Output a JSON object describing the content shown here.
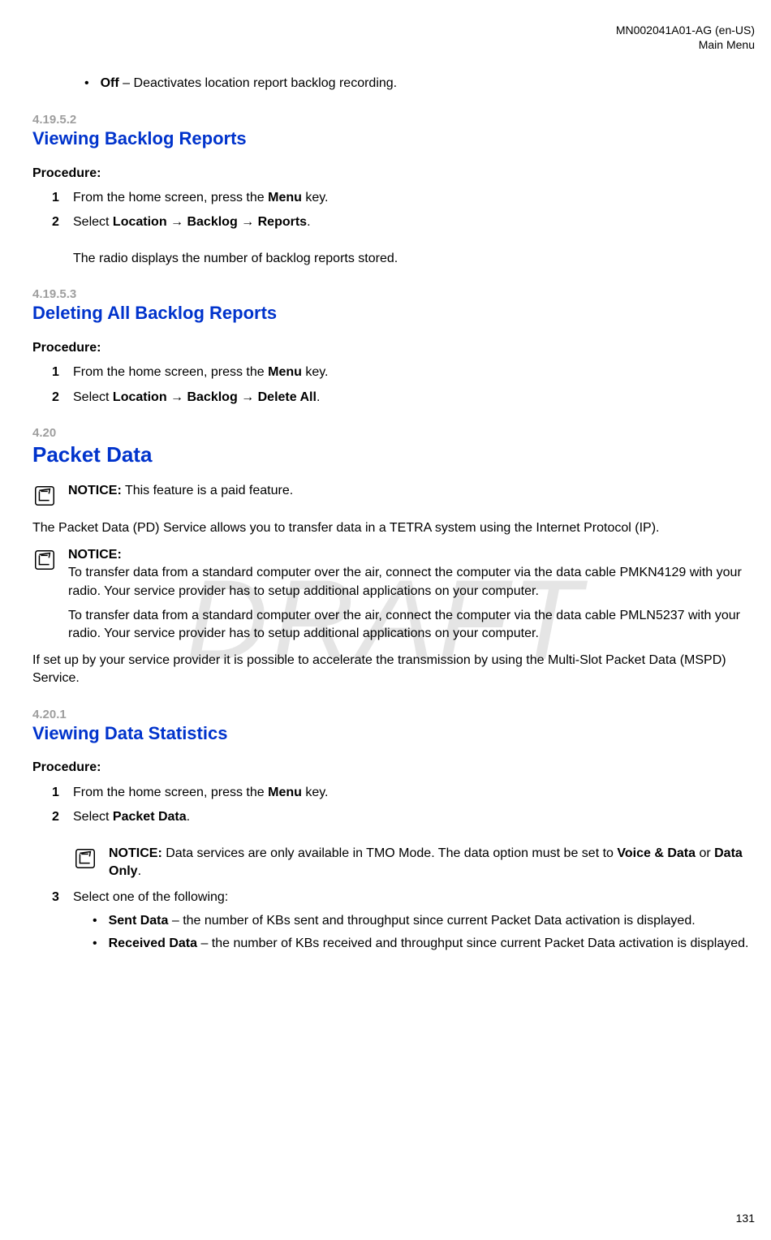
{
  "watermark": "DRAFT",
  "header": {
    "doc_id": "MN002041A01-AG (en-US)",
    "section": "Main Menu"
  },
  "page_number": "131",
  "intro_bullet": {
    "term": "Off",
    "desc": " – Deactivates location report backlog recording."
  },
  "s41952": {
    "num": "4.19.5.2",
    "title": "Viewing Backlog Reports",
    "proc_label": "Procedure:",
    "step1_a": "From the home screen, press the ",
    "step1_b": "Menu",
    "step1_c": " key.",
    "step2_a": "Select ",
    "step2_b": "Location → Backlog → Reports",
    "step2_c": ".",
    "result": "The radio displays the number of backlog reports stored."
  },
  "s41953": {
    "num": "4.19.5.3",
    "title": "Deleting All Backlog Reports",
    "proc_label": "Procedure:",
    "step1_a": "From the home screen, press the ",
    "step1_b": "Menu",
    "step1_c": " key.",
    "step2_a": "Select ",
    "step2_b": "Location → Backlog → Delete All",
    "step2_c": "."
  },
  "s420": {
    "num": "4.20",
    "title": "Packet Data",
    "notice1_label": "NOTICE:",
    "notice1_text": " This feature is a paid feature.",
    "para1": "The Packet Data (PD) Service allows you to transfer data in a TETRA system using the Internet Protocol (IP).",
    "notice2_label": "NOTICE:",
    "notice2_p1": "To transfer data from a standard computer over the air, connect the computer via the data cable PMKN4129 with your radio. Your service provider has to setup additional applications on your computer.",
    "notice2_p2": "To transfer data from a standard computer over the air, connect the computer via the data cable PMLN5237 with your radio. Your service provider has to setup additional applications on your computer.",
    "para2": "If set up by your service provider it is possible to accelerate the transmission by using the Multi-Slot Packet Data (MSPD) Service."
  },
  "s4201": {
    "num": "4.20.1",
    "title": "Viewing Data Statistics",
    "proc_label": "Procedure:",
    "step1_a": "From the home screen, press the ",
    "step1_b": "Menu",
    "step1_c": " key.",
    "step2_a": "Select ",
    "step2_b": "Packet Data",
    "step2_c": ".",
    "notice_label": "NOTICE:",
    "notice_a": " Data services are only available in TMO Mode. The data option must be set to ",
    "notice_b": "Voice & Data",
    "notice_c": " or ",
    "notice_d": "Data Only",
    "notice_e": ".",
    "step3": "Select one of the following:",
    "b1_term": "Sent Data",
    "b1_desc": " – the number of KBs sent and throughput since current Packet Data activation is displayed.",
    "b2_term": "Received Data",
    "b2_desc": " – the number of KBs received and throughput since current Packet Data activation is displayed."
  }
}
